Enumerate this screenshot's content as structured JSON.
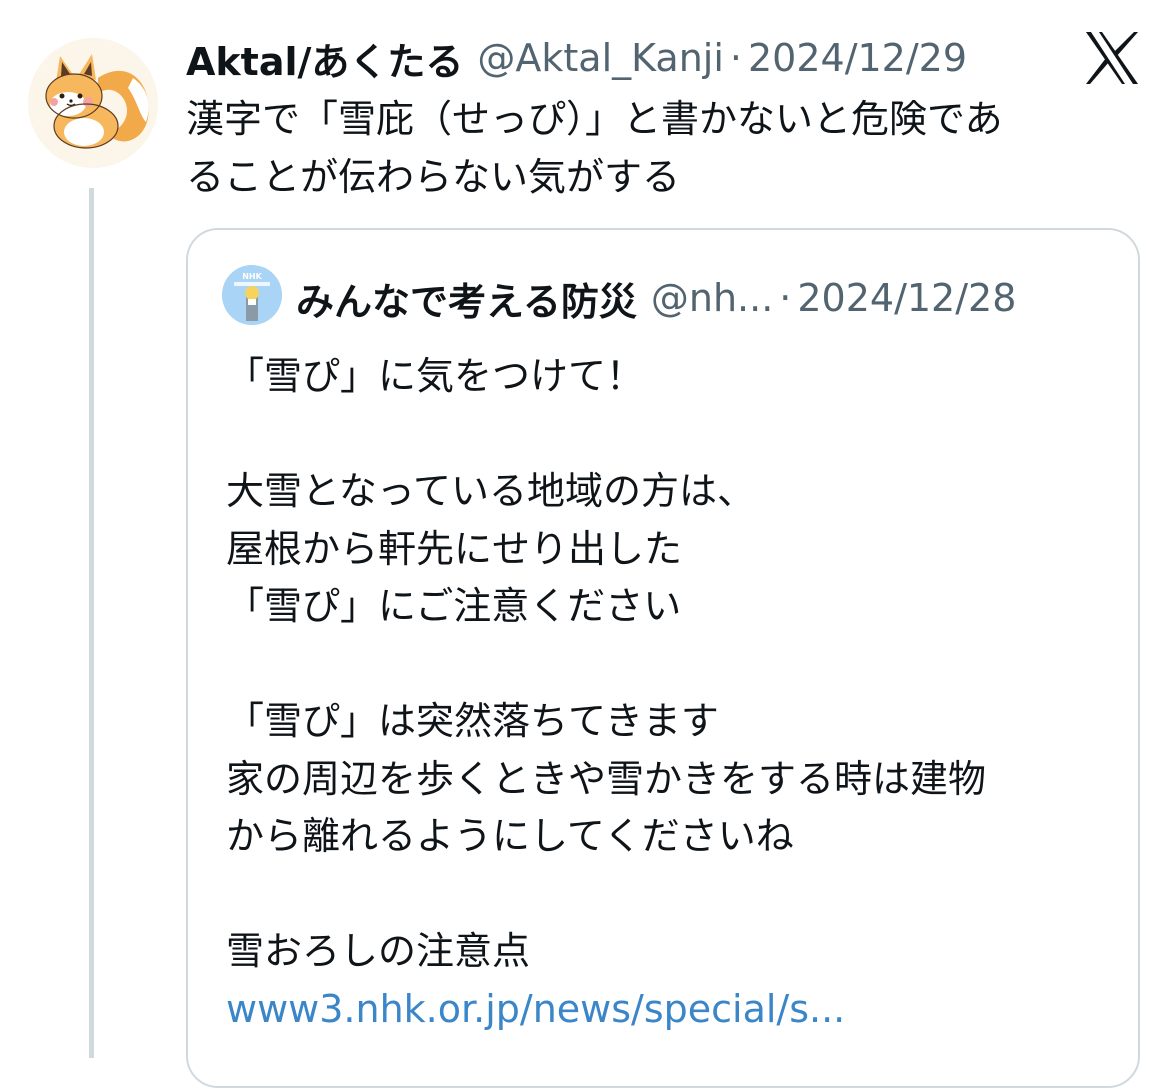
{
  "tweet": {
    "author_name": "Aktal/あくたる",
    "author_handle": "@Aktal_Kanji",
    "separator": "·",
    "date": "2024/12/29",
    "text_lines": [
      "漢字で「雪庇（せっぴ）」と書かないと危険であ",
      "ることが伝わらない気がする"
    ]
  },
  "quote": {
    "author_name": "みんなで考える防災",
    "author_handle": "@nh...",
    "separator": "·",
    "date": "2024/12/28",
    "avatar_text": "NHK",
    "body_lines": [
      "「雪ぴ」に気をつけて！",
      "",
      "大雪となっている地域の方は、",
      "屋根から軒先にせり出した",
      "「雪ぴ」にご注意ください",
      "",
      "「雪ぴ」は突然落ちてきます",
      "家の周辺を歩くときや雪かきをする時は建物",
      "から離れるようにしてくださいね",
      "",
      "雪おろしの注意点"
    ],
    "link_text": "www3.nhk.or.jp/news/special/s..."
  },
  "icons": {
    "platform_logo": "x-logo-icon",
    "author_avatar": "fox-avatar-icon",
    "quote_avatar": "nhk-bousai-avatar-icon"
  },
  "colors": {
    "text_primary": "#0f1419",
    "text_secondary": "#536471",
    "link": "#3a86c8",
    "border": "#cfd9de"
  }
}
